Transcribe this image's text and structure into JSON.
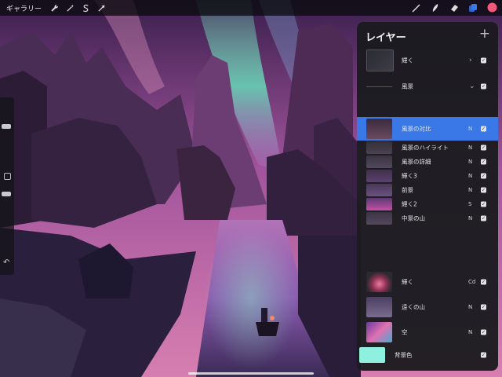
{
  "toolbar": {
    "gallery_label": "ギャラリー",
    "left_icons": [
      "wrench-icon",
      "magic-wand-icon",
      "selection-s-icon",
      "transform-arrow-icon"
    ],
    "right_icons": [
      "brush-icon",
      "smudge-icon",
      "eraser-icon",
      "layers-icon",
      "color-swatch-icon"
    ],
    "color_swatch": "#f05a7a",
    "layers_active_color": "#3b78e7"
  },
  "layers_panel": {
    "title": "レイヤー",
    "add_symbol": "+",
    "layers": [
      {
        "name": "輝く",
        "mode": "",
        "kind": "group",
        "expanded": false,
        "checked": true
      },
      {
        "name": "風景",
        "mode": "",
        "kind": "group",
        "expanded": true,
        "checked": true
      },
      {
        "name": "風景の対比",
        "mode": "N",
        "kind": "layer",
        "selected": true,
        "checked": true
      },
      {
        "name": "風景のハイライト",
        "mode": "N",
        "kind": "layer",
        "checked": true
      },
      {
        "name": "風景の詳細",
        "mode": "N",
        "kind": "layer",
        "checked": true
      },
      {
        "name": "輝く3",
        "mode": "N",
        "kind": "layer",
        "checked": true
      },
      {
        "name": "前景",
        "mode": "N",
        "kind": "layer",
        "checked": true
      },
      {
        "name": "輝く2",
        "mode": "S",
        "kind": "layer",
        "checked": true
      },
      {
        "name": "中景の山",
        "mode": "N",
        "kind": "layer",
        "checked": true
      },
      {
        "name": "輝く",
        "mode": "Cd",
        "kind": "layer",
        "checked": true
      },
      {
        "name": "遠くの山",
        "mode": "N",
        "kind": "layer",
        "checked": true
      },
      {
        "name": "空",
        "mode": "N",
        "kind": "layer",
        "checked": true
      },
      {
        "name": "背景色",
        "mode": "",
        "kind": "background",
        "checked": true,
        "color": "#8ff0e0"
      }
    ]
  }
}
